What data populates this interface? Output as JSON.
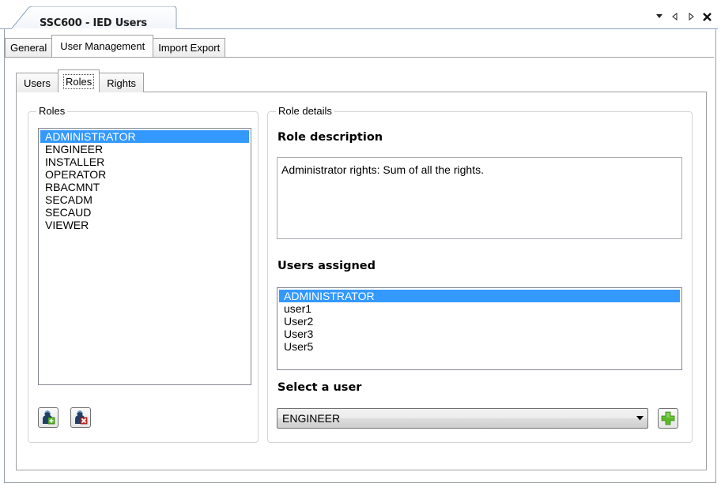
{
  "document": {
    "tab_title": "SSC600 - IED Users"
  },
  "main_tabs": [
    {
      "label": "General"
    },
    {
      "label": "User Management"
    },
    {
      "label": "Import Export"
    }
  ],
  "sub_tabs": [
    {
      "label": "Users"
    },
    {
      "label": "Roles"
    },
    {
      "label": "Rights"
    }
  ],
  "roles_group": {
    "title": "Roles",
    "items": [
      {
        "label": "ADMINISTRATOR",
        "selected": true
      },
      {
        "label": "ENGINEER"
      },
      {
        "label": "INSTALLER"
      },
      {
        "label": "OPERATOR"
      },
      {
        "label": "RBACMNT"
      },
      {
        "label": "SECADM"
      },
      {
        "label": "SECAUD"
      },
      {
        "label": "VIEWER"
      }
    ]
  },
  "details_group": {
    "title": "Role details",
    "description_heading": "Role description",
    "description_text": "Administrator rights: Sum of all the rights.",
    "users_heading": "Users assigned",
    "users": [
      {
        "label": "ADMINISTRATOR",
        "selected": true
      },
      {
        "label": "user1"
      },
      {
        "label": "User2"
      },
      {
        "label": "User3"
      },
      {
        "label": "User5"
      }
    ],
    "select_heading": "Select a user",
    "select_value": "ENGINEER"
  },
  "colors": {
    "selection": "#3399ff",
    "add_icon": "#5dbb2a",
    "tab_accent": "#7a9cc8"
  }
}
